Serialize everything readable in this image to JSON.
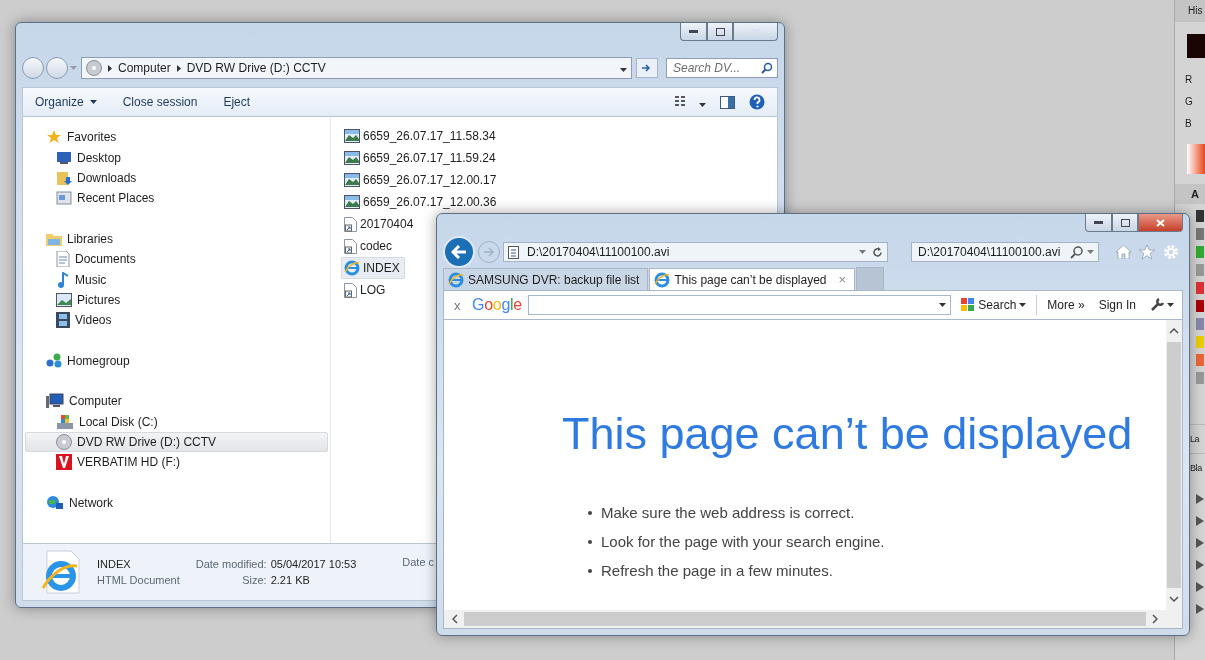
{
  "side_panel": {
    "header": "His",
    "channels": [
      "R",
      "G",
      "B"
    ],
    "section": "A",
    "labels": [
      "La",
      "Bla"
    ]
  },
  "explorer": {
    "breadcrumbs": [
      "Computer",
      "DVD RW Drive (D:) CCTV"
    ],
    "search": {
      "placeholder": "Search DV..."
    },
    "toolbar": [
      {
        "label": "Organize",
        "kind": "menu"
      },
      {
        "label": "Close session",
        "kind": "button"
      },
      {
        "label": "Eject",
        "kind": "button"
      }
    ],
    "nav": [
      {
        "label": "Favorites",
        "selected": false,
        "children": [
          {
            "label": "Desktop",
            "selected": false
          },
          {
            "label": "Downloads",
            "selected": false
          },
          {
            "label": "Recent Places",
            "selected": false
          }
        ]
      },
      {
        "label": "Libraries",
        "selected": false,
        "children": [
          {
            "label": "Documents",
            "selected": false
          },
          {
            "label": "Music",
            "selected": false
          },
          {
            "label": "Pictures",
            "selected": false
          },
          {
            "label": "Videos",
            "selected": false
          }
        ]
      },
      {
        "label": "Homegroup",
        "selected": false
      },
      {
        "label": "Computer",
        "selected": false,
        "children": [
          {
            "label": "Local Disk (C:)",
            "selected": false
          },
          {
            "label": "DVD RW Drive (D:) CCTV",
            "selected": true
          },
          {
            "label": "VERBATIM HD (F:)",
            "selected": false
          }
        ]
      },
      {
        "label": "Network",
        "selected": false
      }
    ],
    "files": [
      {
        "name": "6659_26.07.17_11.58.34",
        "kind": "image",
        "selected": false
      },
      {
        "name": "6659_26.07.17_11.59.24",
        "kind": "image",
        "selected": false
      },
      {
        "name": "6659_26.07.17_12.00.17",
        "kind": "image",
        "selected": false
      },
      {
        "name": "6659_26.07.17_12.00.36",
        "kind": "image",
        "selected": false
      },
      {
        "name": "20170404",
        "kind": "shortcut",
        "selected": false
      },
      {
        "name": "codec",
        "kind": "shortcut",
        "selected": false
      },
      {
        "name": "INDEX",
        "kind": "webpage",
        "selected": true
      },
      {
        "name": "LOG",
        "kind": "shortcut",
        "selected": false
      }
    ],
    "details": {
      "name": "INDEX",
      "type": "HTML Document",
      "fields": [
        {
          "label": "Date modified:",
          "value": "05/04/2017 10:53"
        },
        {
          "label": "Size:",
          "value": "2.21 KB"
        }
      ],
      "cut_label": "Date c"
    }
  },
  "browser": {
    "address": "D:\\20170404\\11100100.avi",
    "search_value": "D:\\20170404\\11100100.avi",
    "tabs": [
      {
        "label": "SAMSUNG DVR: backup file list",
        "selected": false
      },
      {
        "label": "This page can’t be displayed",
        "selected": true,
        "close": "×"
      }
    ],
    "google_bar": {
      "close": "x",
      "logo": "Google",
      "search_button": "Search",
      "more": "More »",
      "sign_in": "Sign In"
    },
    "page": {
      "heading": "This page can’t be displayed",
      "bullets": [
        "Make sure the web address is correct.",
        "Look for the page with your search engine.",
        "Refresh the page in a few minutes."
      ]
    }
  }
}
